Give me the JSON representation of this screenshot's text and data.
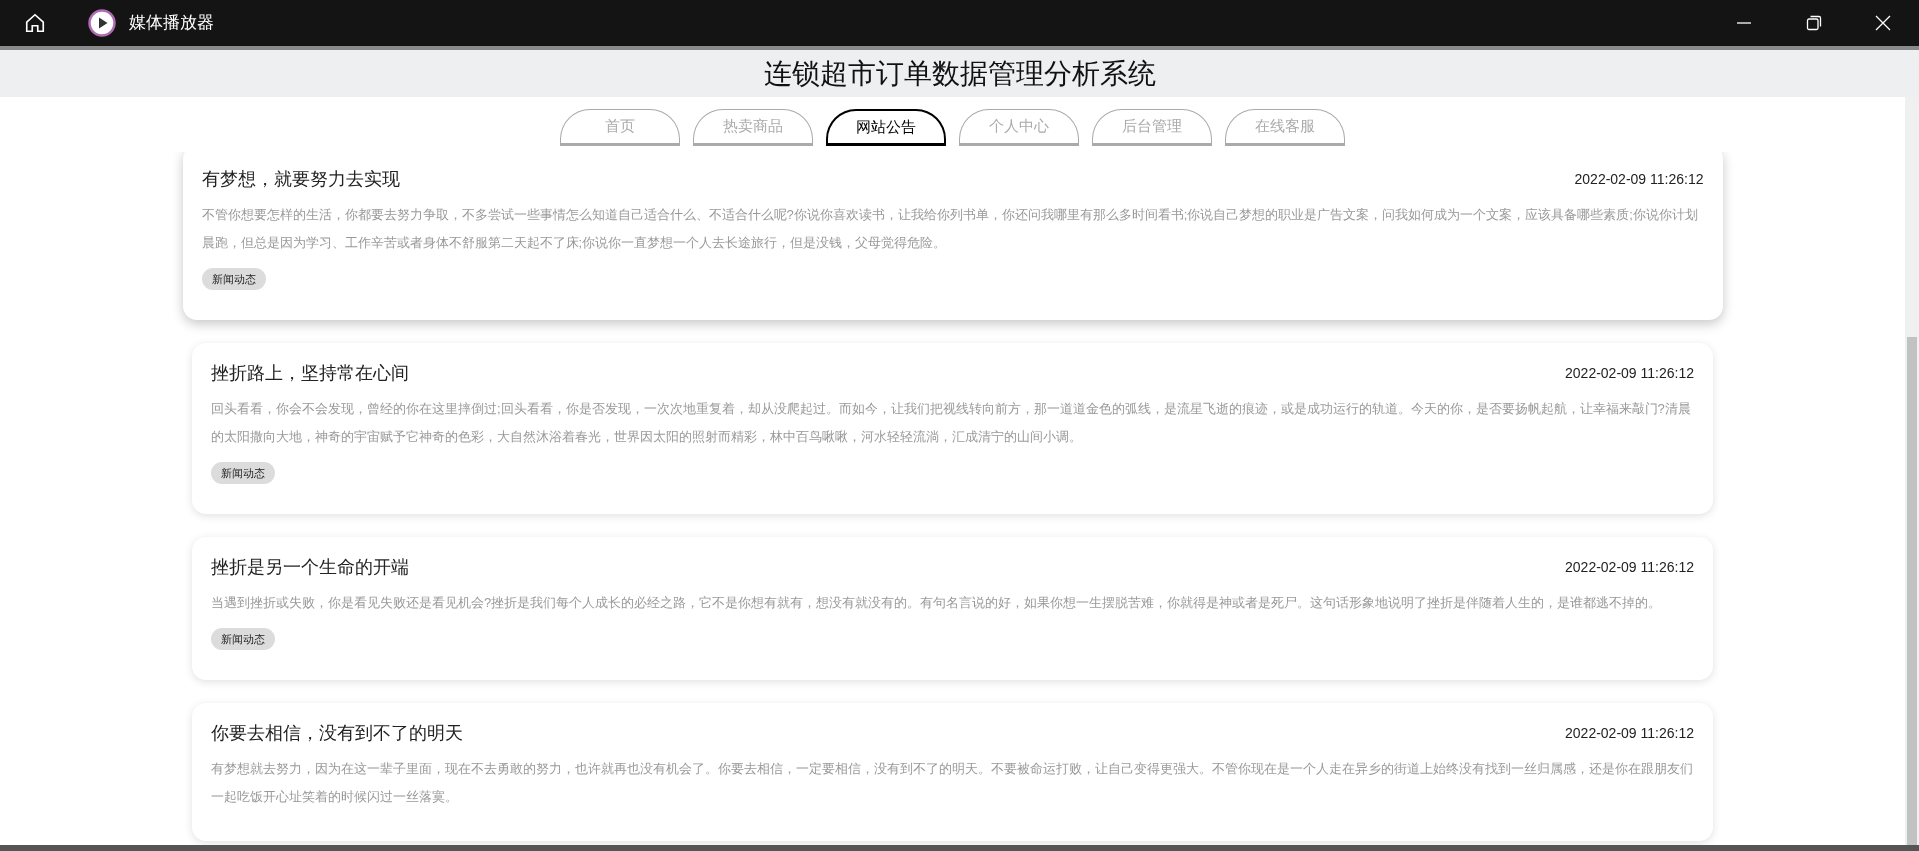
{
  "window": {
    "title": "媒体播放器"
  },
  "page_title": "连锁超市订单数据管理分析系统",
  "tabs": [
    {
      "label": "首页",
      "selected": false
    },
    {
      "label": "热卖商品",
      "selected": false
    },
    {
      "label": "网站公告",
      "selected": true
    },
    {
      "label": "个人中心",
      "selected": false
    },
    {
      "label": "后台管理",
      "selected": false
    },
    {
      "label": "在线客服",
      "selected": false
    }
  ],
  "notices": [
    {
      "title": "有梦想，就要努力去实现",
      "date": "2022-02-09 11:26:12",
      "body": "不管你想要怎样的生活，你都要去努力争取，不多尝试一些事情怎么知道自己适合什么、不适合什么呢?你说你喜欢读书，让我给你列书单，你还问我哪里有那么多时间看书;你说自己梦想的职业是广告文案，问我如何成为一个文案，应该具备哪些素质;你说你计划晨跑，但总是因为学习、工作辛苦或者身体不舒服第二天起不了床;你说你一直梦想一个人去长途旅行，但是没钱，父母觉得危险。",
      "tag": "新闻动态",
      "hovered": true
    },
    {
      "title": "挫折路上，坚持常在心间",
      "date": "2022-02-09 11:26:12",
      "body": "回头看看，你会不会发现，曾经的你在这里摔倒过;回头看看，你是否发现，一次次地重复着，却从没爬起过。而如今，让我们把视线转向前方，那一道道金色的弧线，是流星飞逝的痕迹，或是成功运行的轨道。今天的你，是否要扬帆起航，让幸福来敲门?清晨的太阳撒向大地，神奇的宇宙赋予它神奇的色彩，大自然沐浴着春光，世界因太阳的照射而精彩，林中百鸟啾啾，河水轻轻流淌，汇成清宁的山间小调。",
      "tag": "新闻动态",
      "hovered": false
    },
    {
      "title": "挫折是另一个生命的开端",
      "date": "2022-02-09 11:26:12",
      "body": "当遇到挫折或失败，你是看见失败还是看见机会?挫折是我们每个人成长的必经之路，它不是你想有就有，想没有就没有的。有句名言说的好，如果你想一生摆脱苦难，你就得是神或者是死尸。这句话形象地说明了挫折是伴随着人生的，是谁都逃不掉的。",
      "tag": "新闻动态",
      "hovered": false
    },
    {
      "title": "你要去相信，没有到不了的明天",
      "date": "2022-02-09 11:26:12",
      "body": "有梦想就去努力，因为在这一辈子里面，现在不去勇敢的努力，也许就再也没有机会了。你要去相信，一定要相信，没有到不了的明天。不要被命运打败，让自己变得更强大。不管你现在是一个人走在异乡的街道上始终没有找到一丝归属感，还是你在跟朋友们一起吃饭开心址笑着的时候闪过一丝落寞。",
      "hovered": false
    }
  ]
}
